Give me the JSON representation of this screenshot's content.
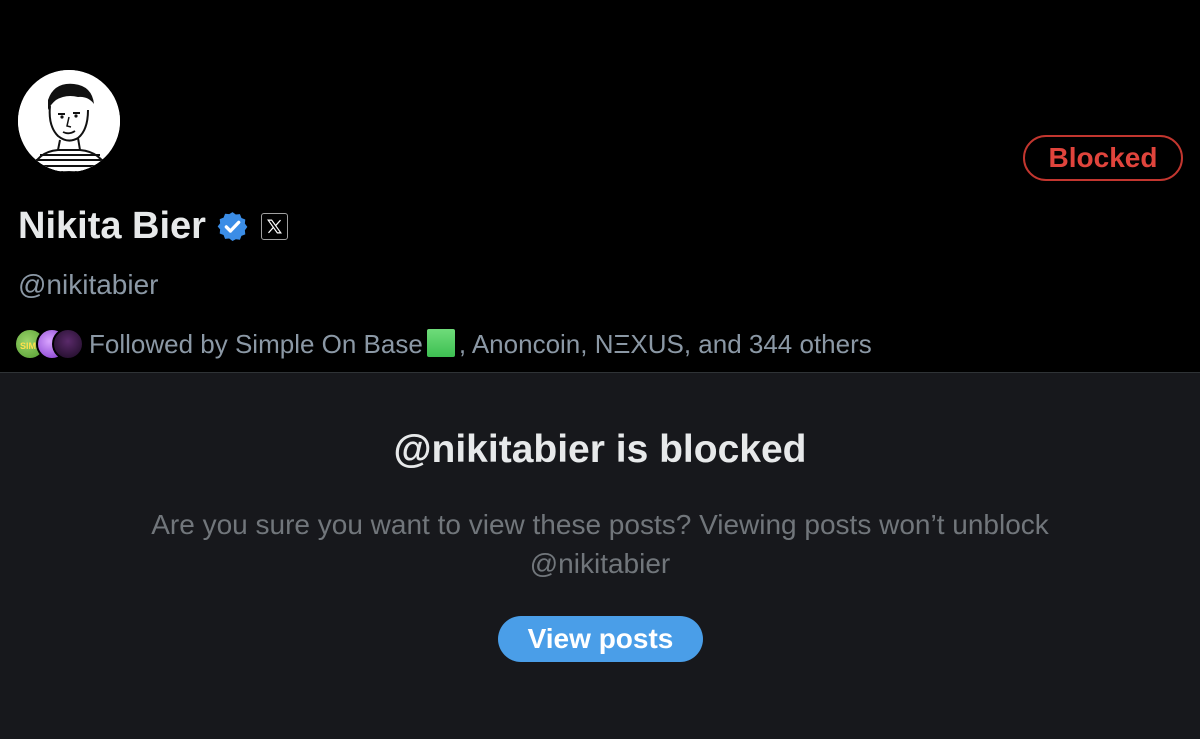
{
  "profile": {
    "display_name": "Nikita Bier",
    "handle": "@nikitabier",
    "verified_icon": "verified-badge-icon",
    "affiliate_icon": "x-logo-icon",
    "blocked_label": "Blocked",
    "followed_by_prefix": "Followed by Simple On Base",
    "followed_by_suffix": ", Anoncoin, NΞXUS, and 344 others",
    "mini_avatar_label": "SIMP"
  },
  "blocked_notice": {
    "title": "@nikitabier is blocked",
    "description_line1": "Are you sure you want to view these posts? Viewing posts won’t unblock",
    "description_line2": "@nikitabier",
    "button_label": "View posts"
  },
  "colors": {
    "background": "#000000",
    "panel": "#17181c",
    "accent": "#4a9ee8",
    "blocked_red": "#e0443c",
    "muted_text": "#71767b"
  }
}
